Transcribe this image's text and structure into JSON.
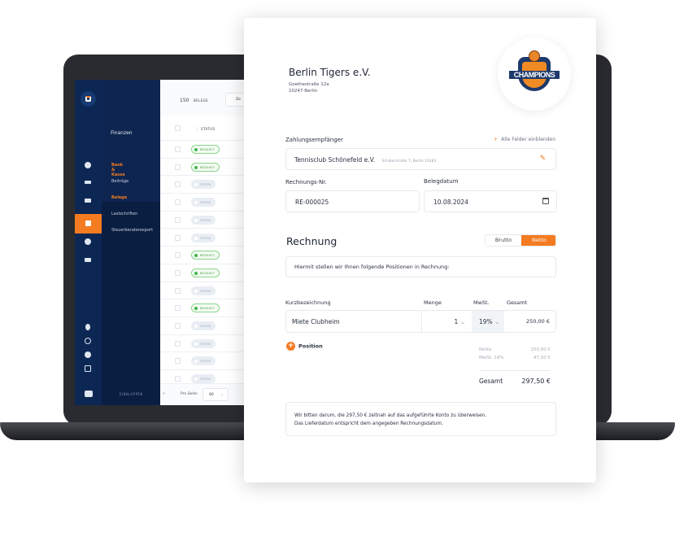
{
  "app": {
    "count": "150",
    "count_label": "BELEGE",
    "date_filter": "Ze",
    "status_header": "STATUS",
    "menu_title": "Finanzen",
    "menu_items": [
      {
        "label": "Bank & Kasse",
        "active": true
      },
      {
        "label": "Beiträge",
        "active": false
      },
      {
        "label": "Belege",
        "active": true
      },
      {
        "label": "Lastschriften",
        "active": false
      },
      {
        "label": "Steuerberaterexport",
        "active": false
      }
    ],
    "collapse_label": "EINKLAPPEN",
    "per_page_label": "Pro Seite:",
    "per_page_value": "40",
    "rows": [
      "BEZAHLT",
      "BEZAHLT",
      "OFFEN",
      "OFFEN",
      "OFFEN",
      "OFFEN",
      "BEZAHLT",
      "BEZAHLT",
      "OFFEN",
      "BEZAHLT",
      "OFFEN",
      "OFFEN",
      "OFFEN",
      "OFFEN"
    ],
    "icons": [
      "dashboard-icon",
      "list-icon",
      "org-icon",
      "finance-icon",
      "gear-icon",
      "megaphone-icon",
      "bell-icon",
      "search-icon",
      "info-icon",
      "logout-icon"
    ]
  },
  "invoice": {
    "org_name": "Berlin Tigers e.V.",
    "address1": "Goethestraße 12a",
    "address2": "10247 Berlin",
    "logo_text": "CHAMPIONS",
    "logo_year": "2016",
    "recipient_label": "Zahlungsempfänger",
    "show_all_fields": "Alle Felder einblenden",
    "recipient_name": "Tennisclub Schönefeld e.V.",
    "recipient_address": "Schillerstraße 7, Berlin 10283",
    "invoice_no_label": "Rechnungs-Nr.",
    "invoice_no": "RE-000025",
    "date_label": "Belegdatum",
    "date": "10.08.2024",
    "section_title": "Rechnung",
    "toggle": {
      "brutto": "Brutto",
      "netto": "Netto",
      "selected": "Netto"
    },
    "intro": "Hiermit stellen wir Ihnen folgende Positionen in Rechnung:",
    "columns": {
      "desc": "Kurzbezeichnung",
      "qty": "Menge",
      "vat": "MwSt.",
      "total": "Gesamt"
    },
    "item": {
      "desc": "Miete Clubheim",
      "qty": "1",
      "vat": "19%",
      "total": "250,00 €"
    },
    "add_position": "Position",
    "summary": {
      "netto_label": "Netto",
      "netto": "250,00 €",
      "vat_label": "MwSt. 19%",
      "vat": "47,50 €",
      "total_label": "Gesamt",
      "total": "297,50 €"
    },
    "footer1": "Wir bitten darum, die 297,50 € zeitnah auf das aufgeführte Konto zu überweisen.",
    "footer2": "Das Lieferdatum entspricht dem angegeben Rechnungsdatum."
  },
  "colors": {
    "accent": "#f47b20",
    "navy": "#0c2753",
    "paid": "#3fb54a"
  }
}
